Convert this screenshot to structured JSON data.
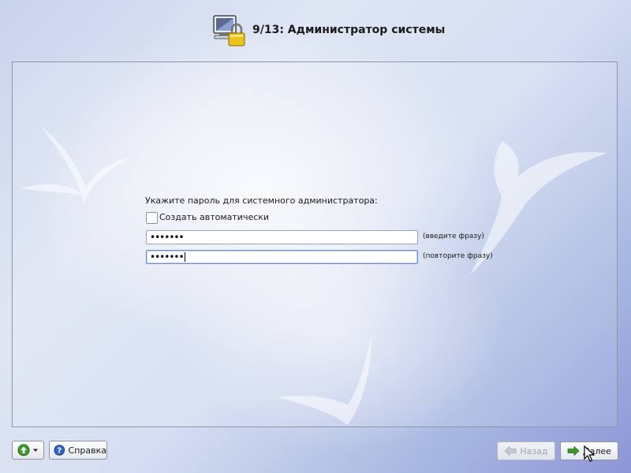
{
  "header": {
    "title": "9/13: Администратор системы",
    "icon": "computer-lock-icon"
  },
  "form": {
    "prompt": "Укажите пароль для системного администратора:",
    "auto_checkbox": {
      "label": "Создать автоматически",
      "checked": false
    },
    "password": {
      "value": "•••••••",
      "hint": "(введите фразу)"
    },
    "password_repeat": {
      "value": "•••••••",
      "hint": "(повторите фразу)"
    }
  },
  "footer": {
    "menu_button": {
      "icon": "green-up-arrow-icon"
    },
    "help_button": {
      "label": "Справка",
      "icon": "help-question-icon"
    },
    "back_button": {
      "label": "Назад",
      "enabled": false
    },
    "next_button": {
      "label": "Далее",
      "enabled": true
    }
  },
  "colors": {
    "accent_green": "#3c9a2a",
    "help_blue": "#2f63c8",
    "panel_border": "#8f96a8"
  }
}
